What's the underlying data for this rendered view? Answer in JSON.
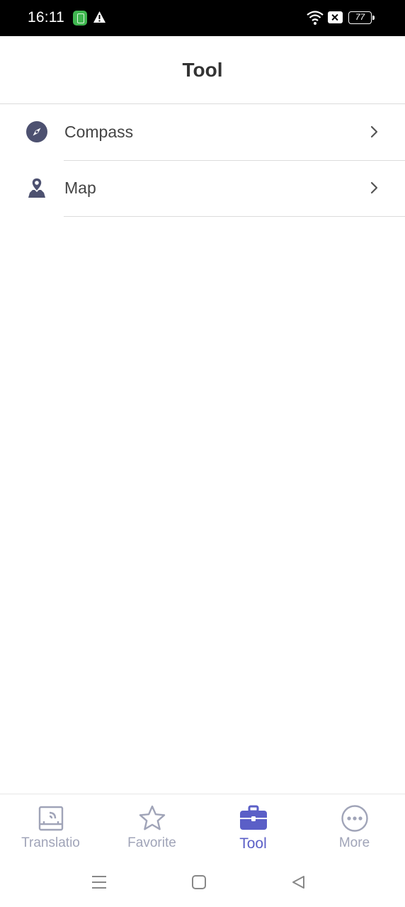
{
  "status_bar": {
    "time": "16:11",
    "battery": "77",
    "icons": [
      "app-notification-icon",
      "warning-icon",
      "wifi-icon",
      "mute-icon",
      "battery-icon"
    ]
  },
  "header": {
    "title": "Tool"
  },
  "tools": [
    {
      "label": "Compass",
      "icon": "compass-icon"
    },
    {
      "label": "Map",
      "icon": "map-pin-icon"
    }
  ],
  "tab_bar": {
    "tabs": [
      {
        "label": "Translatio",
        "icon": "translation-icon",
        "active": false
      },
      {
        "label": "Favorite",
        "icon": "star-icon",
        "active": false
      },
      {
        "label": "Tool",
        "icon": "toolbox-icon",
        "active": true
      },
      {
        "label": "More",
        "icon": "more-icon",
        "active": false
      }
    ]
  },
  "nav_bar": {
    "buttons": [
      "menu-icon",
      "home-icon",
      "back-icon"
    ]
  },
  "colors": {
    "accent": "#5b5fc7",
    "inactive": "#a0a4b8",
    "icon_dark": "#4d5170",
    "text": "#444444",
    "divider": "#dcdcdc"
  }
}
